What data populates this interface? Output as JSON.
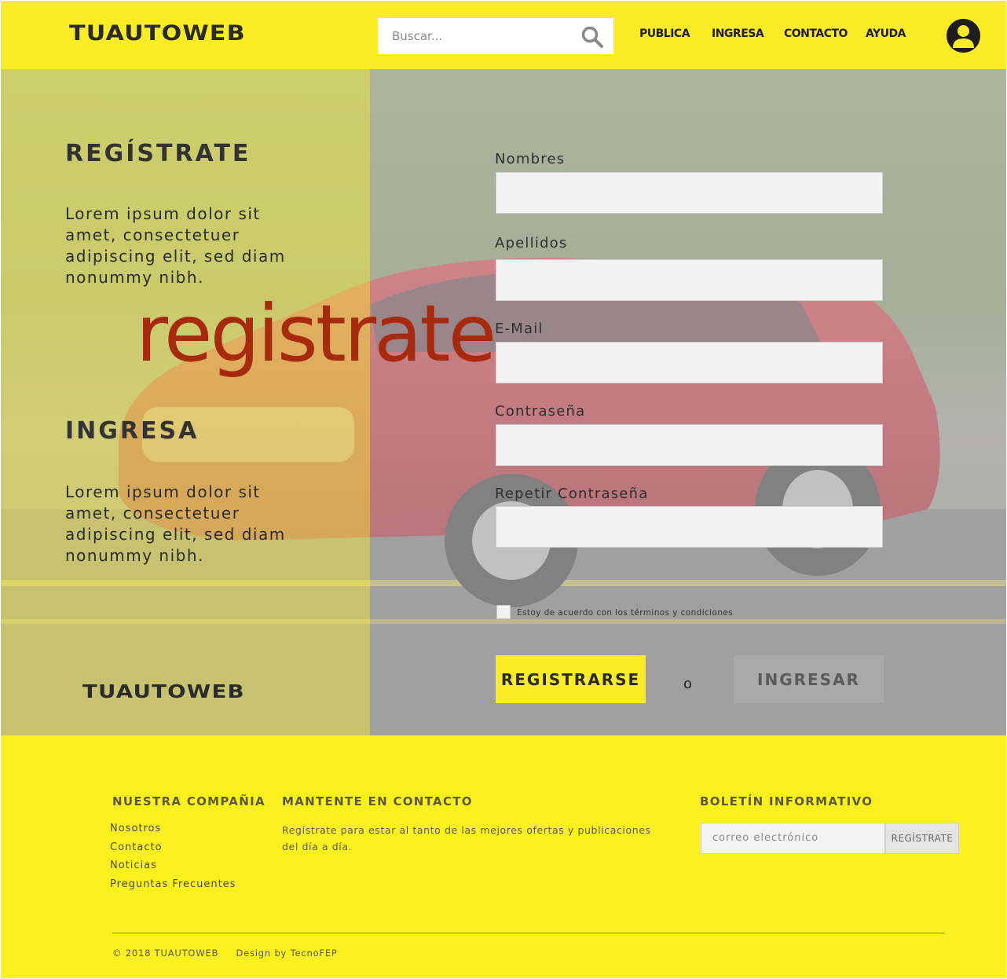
{
  "header": {
    "logo": "TUAUTOWEB",
    "search": {
      "placeholder": "Buscar..."
    },
    "nav": [
      "PUBLICA",
      "INGRESA",
      "CONTACTO",
      "AYUDA"
    ],
    "colors": {
      "brand_yellow": "#fcec26",
      "dark": "#1d1d1d"
    },
    "icons": {
      "search": "search-icon",
      "user": "user-icon"
    }
  },
  "hero": {
    "register_title": "REGÍSTRATE",
    "register_text": "Lorem ipsum dolor sit amet, consectetuer adipiscing elit, sed diam nonummy nibh.",
    "overlay_word": "registrate",
    "login_title": "INGRESA",
    "login_text": "Lorem ipsum dolor sit amet, consectetuer adipiscing elit, sed diam nonummy nibh.",
    "logo": "TUAUTOWEB",
    "overlay_word_color": "#a72a0e"
  },
  "form": {
    "fields": [
      {
        "label": "Nombres",
        "value": ""
      },
      {
        "label": "Apellidos",
        "value": ""
      },
      {
        "label": "E-Mail",
        "value": ""
      },
      {
        "label": "Contraseña",
        "value": ""
      },
      {
        "label": "Repetir Contraseña",
        "value": ""
      }
    ],
    "terms_label": "Estoy de acuerdo con los términos y condiciones",
    "terms_checked": false,
    "register_button": "REGISTRARSE",
    "or_text": "o",
    "login_button": "INGRESAR"
  },
  "footer": {
    "company_heading": "NUESTRA COMPAÑIA",
    "company_links": [
      "Nosotros",
      "Contacto",
      "Noticias",
      "Preguntas Frecuentes"
    ],
    "contact_heading": "MANTENTE EN CONTACTO",
    "contact_text": "Regístrate para estar al tanto de las mejores ofertas y publicaciones del día a día.",
    "newsletter_heading": "BOLETÍN INFORMATIVO",
    "newsletter_placeholder": "correo electrónico",
    "newsletter_button": "REGÍSTRATE",
    "copyright": "© 2018 TUAUTOWEB     Design by TecnoFEP"
  }
}
